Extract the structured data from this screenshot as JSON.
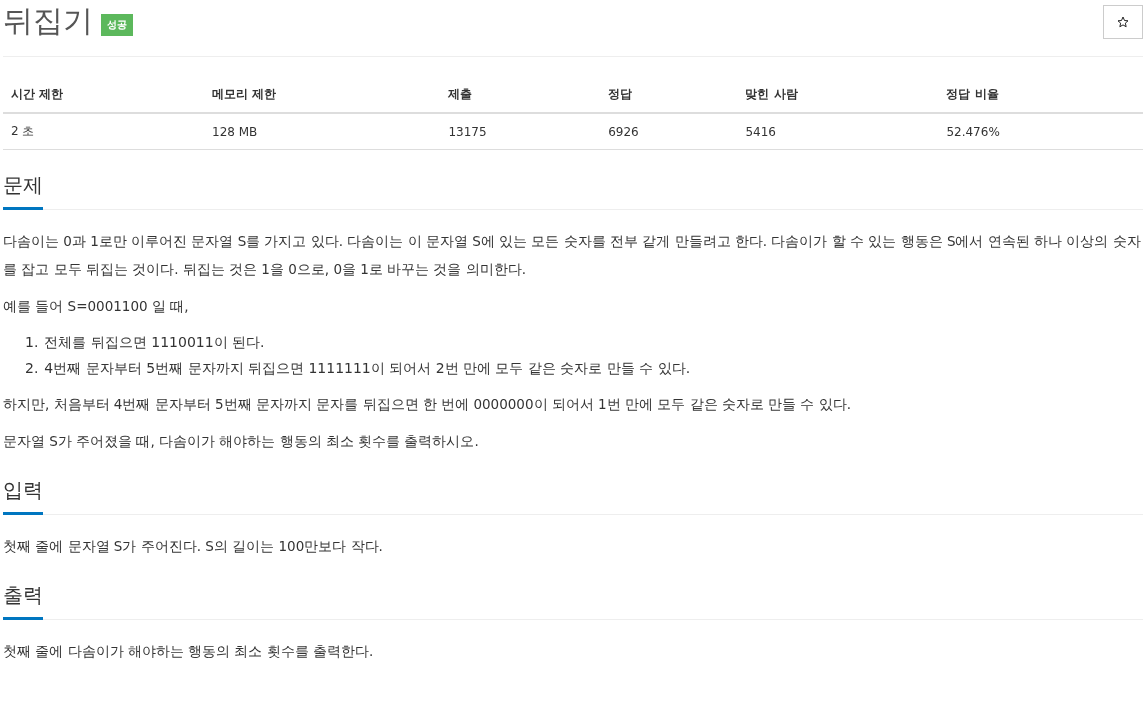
{
  "title": "뒤집기",
  "badge": "성공",
  "stats": {
    "columns": [
      "시간 제한",
      "메모리 제한",
      "제출",
      "정답",
      "맞힌 사람",
      "정답 비율"
    ],
    "values": [
      "2 초",
      "128 MB",
      "13175",
      "6926",
      "5416",
      "52.476%"
    ]
  },
  "sections": [
    {
      "title": "문제",
      "blocks": [
        {
          "kind": "p",
          "text": "다솜이는 0과 1로만 이루어진 문자열 S를 가지고 있다. 다솜이는 이 문자열 S에 있는 모든 숫자를 전부 같게 만들려고 한다. 다솜이가 할 수 있는 행동은 S에서 연속된 하나 이상의 숫자를 잡고 모두 뒤집는 것이다. 뒤집는 것은 1을 0으로, 0을 1로 바꾸는 것을 의미한다."
        },
        {
          "kind": "p",
          "text": "예를 들어 S=0001100 일 때,"
        },
        {
          "kind": "ol",
          "items": [
            {
              "marker": "1.",
              "text": "전체를 뒤집으면 1110011이 된다."
            },
            {
              "marker": "2.",
              "text": "4번째 문자부터 5번째 문자까지 뒤집으면 1111111이 되어서 2번 만에 모두 같은 숫자로 만들 수 있다."
            }
          ]
        },
        {
          "kind": "p",
          "text": "하지만, 처음부터 4번째 문자부터 5번째 문자까지 문자를 뒤집으면 한 번에 0000000이 되어서 1번 만에 모두 같은 숫자로 만들 수 있다."
        },
        {
          "kind": "p",
          "text": "문자열 S가 주어졌을 때, 다솜이가 해야하는 행동의 최소 횟수를 출력하시오."
        }
      ]
    },
    {
      "title": "입력",
      "blocks": [
        {
          "kind": "p",
          "text": "첫째 줄에 문자열 S가 주어진다. S의 길이는 100만보다 작다."
        }
      ]
    },
    {
      "title": "출력",
      "blocks": [
        {
          "kind": "p",
          "text": "첫째 줄에 다솜이가 해야하는 행동의 최소 횟수를 출력한다."
        }
      ]
    }
  ]
}
